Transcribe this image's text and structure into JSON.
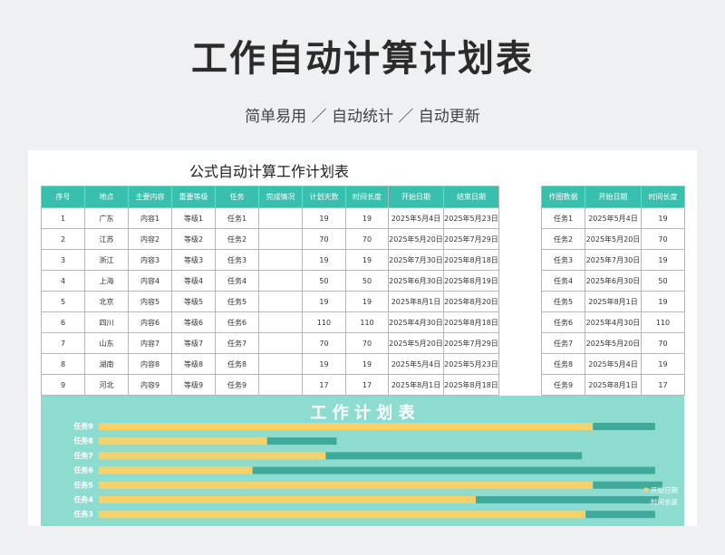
{
  "header": {
    "title": "工作自动计算计划表",
    "subtitle": "简单易用 ／ 自动统计 ／ 自动更新"
  },
  "sheet": {
    "title": "公式自动计算工作计划表",
    "columns": [
      "序号",
      "地点",
      "主要内容",
      "重要等级",
      "任务",
      "完成情况",
      "计划天数",
      "时间长度",
      "开始日期",
      "结束日期"
    ],
    "rows": [
      [
        "1",
        "广东",
        "内容1",
        "等级1",
        "任务1",
        "",
        "19",
        "19",
        "2025年5月4日",
        "2025年5月23日"
      ],
      [
        "2",
        "江苏",
        "内容2",
        "等级2",
        "任务2",
        "",
        "70",
        "70",
        "2025年5月20日",
        "2025年7月29日"
      ],
      [
        "3",
        "浙江",
        "内容3",
        "等级3",
        "任务3",
        "",
        "19",
        "19",
        "2025年7月30日",
        "2025年8月18日"
      ],
      [
        "4",
        "上海",
        "内容4",
        "等级4",
        "任务4",
        "",
        "50",
        "50",
        "2025年6月30日",
        "2025年8月19日"
      ],
      [
        "5",
        "北京",
        "内容5",
        "等级5",
        "任务5",
        "",
        "19",
        "19",
        "2025年8月1日",
        "2025年8月20日"
      ],
      [
        "6",
        "四川",
        "内容6",
        "等级6",
        "任务6",
        "",
        "110",
        "110",
        "2025年4月30日",
        "2025年8月18日"
      ],
      [
        "7",
        "山东",
        "内容7",
        "等级7",
        "任务7",
        "",
        "70",
        "70",
        "2025年5月20日",
        "2025年7月29日"
      ],
      [
        "8",
        "湖南",
        "内容8",
        "等级8",
        "任务8",
        "",
        "19",
        "19",
        "2025年5月4日",
        "2025年5月23日"
      ],
      [
        "9",
        "河北",
        "内容9",
        "等级9",
        "任务9",
        "",
        "17",
        "17",
        "2025年8月1日",
        "2025年8月18日"
      ]
    ]
  },
  "side": {
    "columns": [
      "作图数据",
      "开始日期",
      "时间长度"
    ],
    "rows": [
      [
        "任务1",
        "2025年5月4日",
        "19"
      ],
      [
        "任务2",
        "2025年5月20日",
        "70"
      ],
      [
        "任务3",
        "2025年7月30日",
        "19"
      ],
      [
        "任务4",
        "2025年6月30日",
        "50"
      ],
      [
        "任务5",
        "2025年8月1日",
        "19"
      ],
      [
        "任务6",
        "2025年4月30日",
        "110"
      ],
      [
        "任务7",
        "2025年5月20日",
        "70"
      ],
      [
        "任务8",
        "2025年5月4日",
        "19"
      ],
      [
        "任务9",
        "2025年8月1日",
        "17"
      ]
    ]
  },
  "chart_data": {
    "type": "bar",
    "title": "工 作 计 划 表",
    "categories": [
      "任务9",
      "任务8",
      "任务7",
      "任务6",
      "任务5",
      "任务4",
      "任务3"
    ],
    "series": [
      {
        "name": "开始日期",
        "values": [
          "2025-08-01",
          "2025-05-04",
          "2025-05-20",
          "2025-04-30",
          "2025-08-01",
          "2025-06-30",
          "2025-07-30"
        ]
      },
      {
        "name": "时间长度",
        "values": [
          17,
          19,
          70,
          110,
          19,
          50,
          19
        ]
      }
    ],
    "legend": "right",
    "colors": {
      "start": "#f7d26b",
      "length": "#3fa99b",
      "background": "#8edccf"
    }
  }
}
